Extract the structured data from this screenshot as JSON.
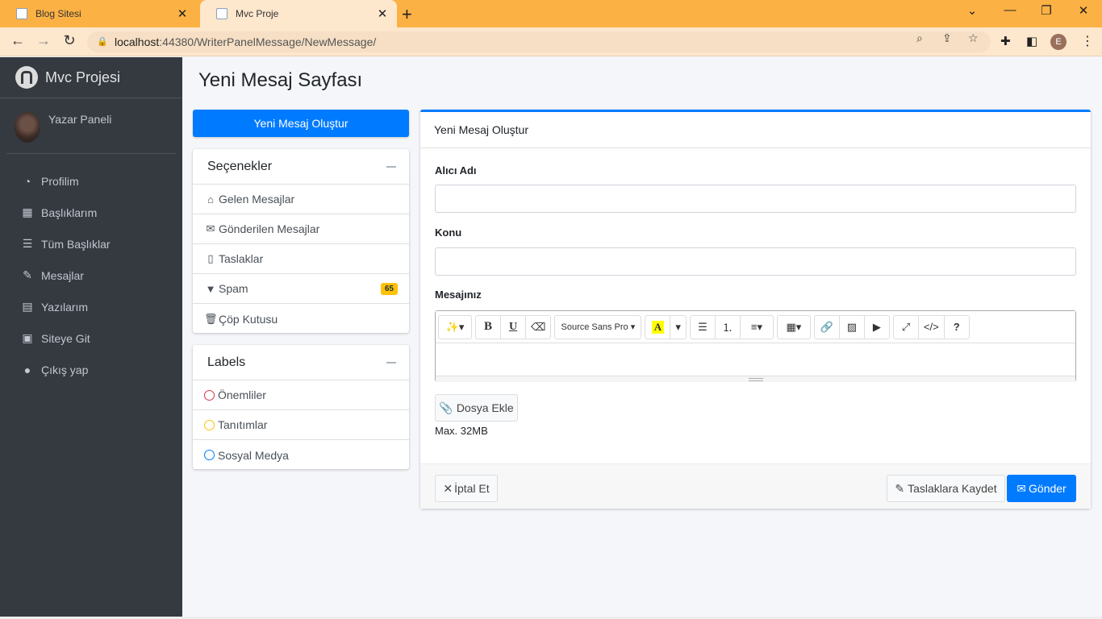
{
  "browser": {
    "tabs": [
      {
        "title": "Blog Sitesi",
        "active": false
      },
      {
        "title": "Mvc Proje",
        "active": true
      }
    ],
    "url_host": "localhost",
    "url_path": ":44380/WriterPanelMessage/NewMessage/",
    "profile_initial": "E"
  },
  "sidebar": {
    "brand": "Mvc Projesi",
    "user_name": "Yazar Paneli",
    "items": [
      {
        "label": "Profilim",
        "icon": "dashboard-icon"
      },
      {
        "label": "Başlıklarım",
        "icon": "grid-icon"
      },
      {
        "label": "Tüm Başlıklar",
        "icon": "list-icon"
      },
      {
        "label": "Mesajlar",
        "icon": "edit-icon"
      },
      {
        "label": "Yazılarım",
        "icon": "calendar-icon"
      },
      {
        "label": "Siteye Git",
        "icon": "document-icon"
      },
      {
        "label": "Çıkış yap",
        "icon": "apple-icon"
      }
    ]
  },
  "page": {
    "title": "Yeni Mesaj Sayfası",
    "new_message_button": "Yeni Mesaj Oluştur"
  },
  "options": {
    "title": "Seçenekler",
    "items": [
      {
        "label": "Gelen Mesajlar",
        "icon": "inbox-icon"
      },
      {
        "label": "Gönderilen Mesajlar",
        "icon": "envelope-icon"
      },
      {
        "label": "Taslaklar",
        "icon": "file-icon"
      },
      {
        "label": "Spam",
        "icon": "filter-icon",
        "badge": "65"
      },
      {
        "label": "Çöp Kutusu",
        "icon": "trash-icon"
      }
    ]
  },
  "labels": {
    "title": "Labels",
    "items": [
      {
        "label": "Önemliler",
        "color": "#dc3545"
      },
      {
        "label": "Tanıtımlar",
        "color": "#ffc107"
      },
      {
        "label": "Sosyal Medya",
        "color": "#007bff"
      }
    ]
  },
  "compose": {
    "title": "Yeni Mesaj Oluştur",
    "recipient_label": "Alıcı Adı",
    "recipient_value": "",
    "subject_label": "Konu",
    "subject_value": "",
    "message_label": "Mesajınız",
    "font_name": "Source Sans Pro",
    "attach_button": "Dosya Ekle",
    "max_size": "Max. 32MB",
    "cancel_button": "İptal Et",
    "draft_button": "Taslaklara Kaydet",
    "send_button": "Gönder"
  },
  "colors": {
    "primary": "#007bff",
    "sidebar": "#343a40",
    "tabbar": "#fcb144",
    "badge": "#ffc107"
  }
}
